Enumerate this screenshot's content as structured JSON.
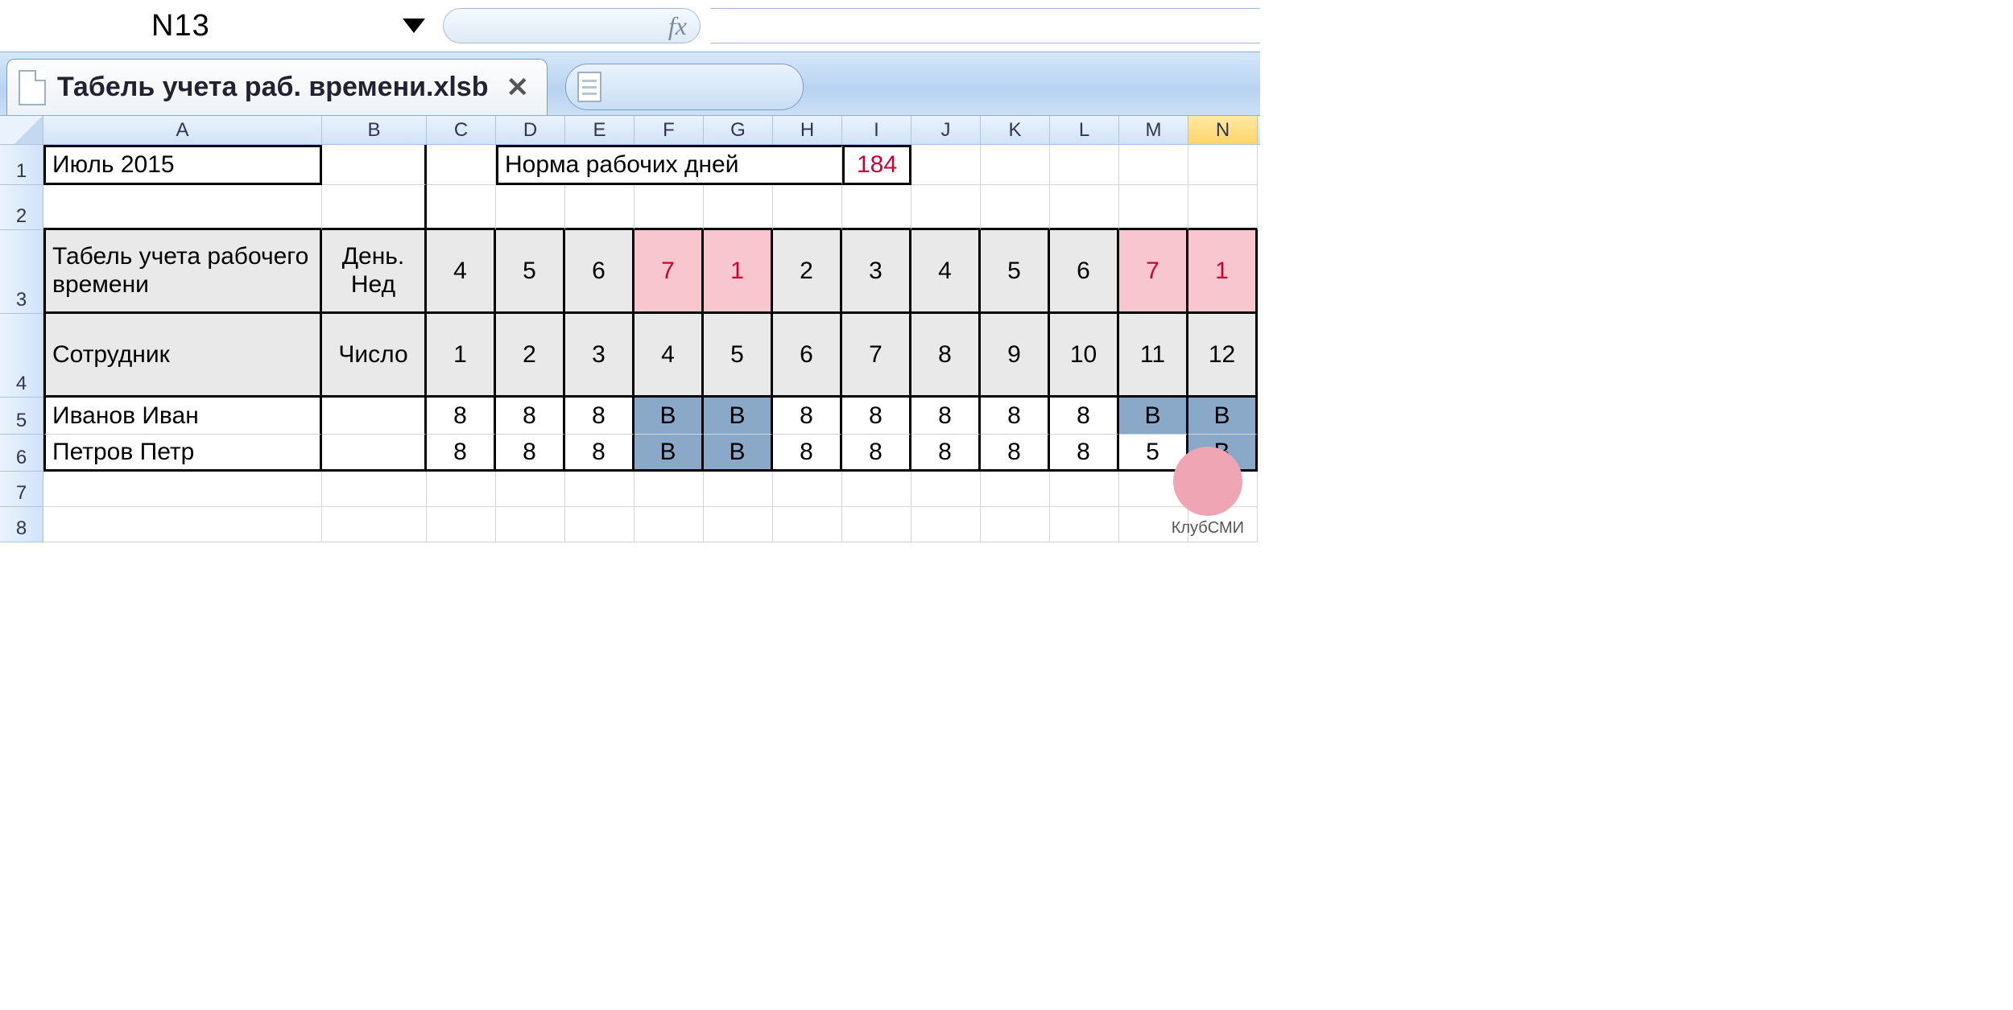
{
  "formula_bar": {
    "cell_ref": "N13",
    "fx_label": "fx",
    "formula_value": ""
  },
  "tabs": {
    "workbook_name": "Табель учета раб. времени.xlsb"
  },
  "columns": [
    "A",
    "B",
    "C",
    "D",
    "E",
    "F",
    "G",
    "H",
    "I",
    "J",
    "K",
    "L",
    "M",
    "N"
  ],
  "selected_column_index": 13,
  "row_numbers": [
    1,
    2,
    3,
    4,
    5,
    6,
    7,
    8
  ],
  "row1": {
    "month": "Июль 2015",
    "norm_label": "Норма рабочих дней",
    "norm_value": "184"
  },
  "headers": {
    "title": "Табель учета рабочего времени",
    "day_of_week_label": "День. Нед",
    "employee_label": "Сотрудник",
    "date_label": "Число"
  },
  "day_of_week": [
    "4",
    "5",
    "6",
    "7",
    "1",
    "2",
    "3",
    "4",
    "5",
    "6",
    "7",
    "1"
  ],
  "day_of_week_weekend_idx": [
    3,
    4,
    10,
    11
  ],
  "dates": [
    "1",
    "2",
    "3",
    "4",
    "5",
    "6",
    "7",
    "8",
    "9",
    "10",
    "11",
    "12"
  ],
  "employees": [
    {
      "name": "Иванов Иван",
      "cells": [
        "8",
        "8",
        "8",
        "В",
        "В",
        "8",
        "8",
        "8",
        "8",
        "8",
        "В",
        "В"
      ],
      "holiday_idx": [
        3,
        4,
        10,
        11
      ]
    },
    {
      "name": "Петров Петр",
      "cells": [
        "8",
        "8",
        "8",
        "В",
        "В",
        "8",
        "8",
        "8",
        "8",
        "8",
        "5",
        "В"
      ],
      "holiday_idx": [
        3,
        4,
        11
      ]
    }
  ],
  "watermark": "КлубСМИ"
}
